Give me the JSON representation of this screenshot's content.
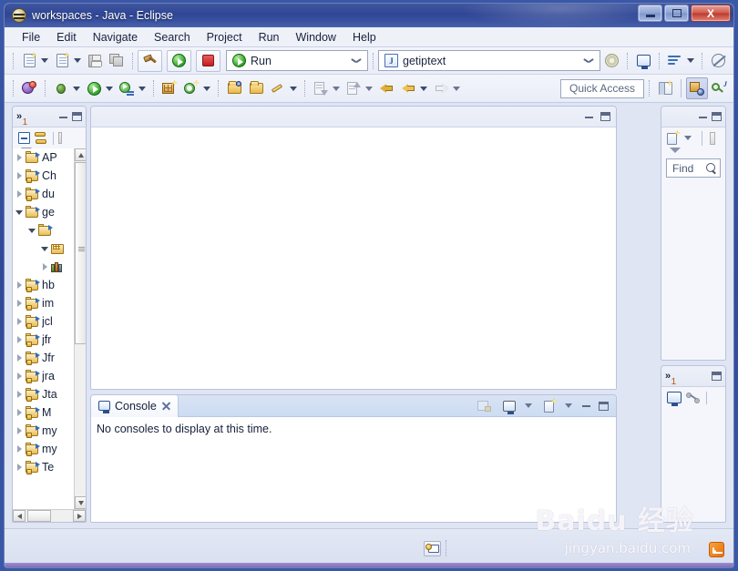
{
  "window": {
    "title": "workspaces - Java - Eclipse",
    "app_icon": "eclipse-icon",
    "minimize_label": "",
    "maximize_label": "",
    "close_label": "X"
  },
  "menubar": {
    "items": [
      {
        "label": "File"
      },
      {
        "label": "Edit"
      },
      {
        "label": "Navigate"
      },
      {
        "label": "Search"
      },
      {
        "label": "Project"
      },
      {
        "label": "Run"
      },
      {
        "label": "Window"
      },
      {
        "label": "Help"
      }
    ]
  },
  "toolbar_main": {
    "new_label": "new-icon",
    "new_wizard_label": "new-java-class-icon",
    "save_label": "save-icon",
    "save_all_label": "save-all-icon",
    "build_label": "build-hammer-icon",
    "run_label": "run-icon",
    "stop_label": "stop-icon",
    "run_combo_value": "Run",
    "launch_combo_value": "getiptext",
    "launch_combo_icon": "J",
    "settings_label": "gear-icon",
    "console_label": "display-console-icon",
    "run_last_label": "run-last-tool-icon",
    "skip_breakpoints_label": "skip-all-breakpoints-icon"
  },
  "toolbar_secondary": {
    "quick_access_placeholder": "Quick Access",
    "items": [
      {
        "name": "open-task-icon"
      },
      {
        "name": "debug-icon"
      },
      {
        "name": "run-icon"
      },
      {
        "name": "run-config-icon"
      },
      {
        "name": "new-package-icon"
      },
      {
        "name": "new-annotation-icon"
      },
      {
        "name": "open-type-icon"
      },
      {
        "name": "open-resource-icon"
      },
      {
        "name": "edit-icon"
      },
      {
        "name": "next-annotation-icon"
      },
      {
        "name": "previous-annotation-icon"
      },
      {
        "name": "back-icon"
      },
      {
        "name": "forward-icon"
      }
    ],
    "perspective_new": "open-perspective-icon",
    "perspective_java": "java-perspective-icon",
    "perspective_browsing": "java-browsing-perspective-icon"
  },
  "package_explorer": {
    "overflow_badge": "1",
    "collapse_all_icon": "collapse-all-icon",
    "link_with_editor_icon": "link-with-editor-icon",
    "view_menu_icon": "view-menu-icon",
    "minimize_icon": "minimize-icon",
    "maximize_icon": "maximize-icon",
    "tree": [
      {
        "label": "AP",
        "icon": "java-project",
        "state": "closed",
        "indent": 0,
        "locked": false
      },
      {
        "label": "Ch",
        "icon": "java-project",
        "state": "closed",
        "indent": 0,
        "locked": true
      },
      {
        "label": "du",
        "icon": "java-project",
        "state": "closed",
        "indent": 0,
        "locked": true
      },
      {
        "label": "ge",
        "icon": "java-project",
        "state": "open",
        "indent": 0,
        "locked": false
      },
      {
        "label": "",
        "icon": "source-folder",
        "state": "open",
        "indent": 1,
        "locked": false
      },
      {
        "label": "",
        "icon": "package",
        "state": "open",
        "indent": 2,
        "locked": false
      },
      {
        "label": "",
        "icon": "library",
        "state": "closed",
        "indent": 2,
        "locked": false
      },
      {
        "label": "hb",
        "icon": "java-project",
        "state": "closed",
        "indent": 0,
        "locked": true
      },
      {
        "label": "im",
        "icon": "java-project",
        "state": "closed",
        "indent": 0,
        "locked": true
      },
      {
        "label": "jcl",
        "icon": "java-project",
        "state": "closed",
        "indent": 0,
        "locked": true
      },
      {
        "label": "jfr",
        "icon": "java-project",
        "state": "closed",
        "indent": 0,
        "locked": true
      },
      {
        "label": "Jfr",
        "icon": "java-project",
        "state": "closed",
        "indent": 0,
        "locked": true
      },
      {
        "label": "jra",
        "icon": "java-project",
        "state": "closed",
        "indent": 0,
        "locked": true
      },
      {
        "label": "Jta",
        "icon": "java-project",
        "state": "closed",
        "indent": 0,
        "locked": true
      },
      {
        "label": "M",
        "icon": "java-project",
        "state": "closed",
        "indent": 0,
        "locked": true
      },
      {
        "label": "my",
        "icon": "java-project",
        "state": "closed",
        "indent": 0,
        "locked": true
      },
      {
        "label": "my",
        "icon": "java-project",
        "state": "closed",
        "indent": 0,
        "locked": true
      },
      {
        "label": "Te",
        "icon": "java-project",
        "state": "closed",
        "indent": 0,
        "locked": true
      }
    ]
  },
  "editor": {
    "tabs": [],
    "minimize_icon": "minimize-icon",
    "maximize_icon": "maximize-icon"
  },
  "console": {
    "tab_label": "Console",
    "tab_icon": "console-icon",
    "close_icon": "close-icon",
    "empty_message": "No consoles to display at this time.",
    "tools": [
      {
        "name": "clear-console-icon"
      },
      {
        "name": "display-selected-console-icon"
      },
      {
        "name": "open-console-icon"
      }
    ],
    "minimize_icon": "minimize-icon",
    "maximize_icon": "maximize-icon"
  },
  "outline_view": {
    "minimize_icon": "minimize-icon",
    "maximize_icon": "maximize-icon",
    "new_icon": "new-view-icon",
    "view_menu_icon": "view-menu-icon",
    "find_placeholder": "Find",
    "find_icon": "search-icon"
  },
  "bottom_right_view": {
    "overflow_badge": "1",
    "maximize_icon": "maximize-icon",
    "console_icon": "console-icon",
    "link_icon": "link-icon"
  },
  "statusbar": {
    "icon": "remote-access-icon",
    "rss_icon": "rss-icon",
    "watermark_brand": "Baidu 经验",
    "watermark_url": "jingyan.baidu.com"
  },
  "colors": {
    "title_blue": "#32499a",
    "chrome": "#dfe5f3",
    "accent_orange": "#e8700f",
    "close_red": "#c01f1f"
  }
}
